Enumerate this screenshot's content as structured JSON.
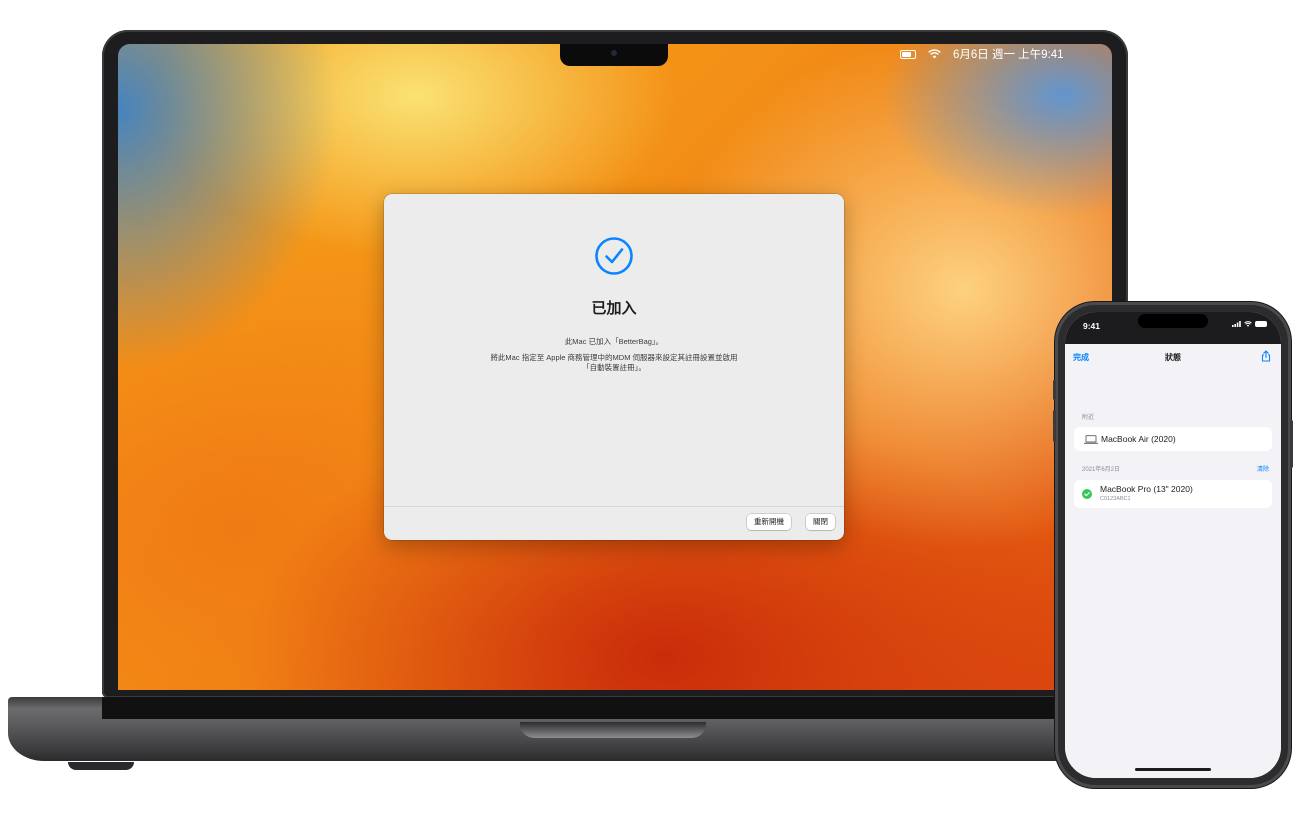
{
  "macbook": {
    "menubar": {
      "icons": [
        "battery-icon",
        "wifi-icon"
      ],
      "datetime": "6月6日 週一 上午9:41"
    },
    "dialog": {
      "icon": "checkmark-circle-icon",
      "title": "已加入",
      "message_line1": "此Mac 已加入「BetterBag」。",
      "message_line2": "將此Mac 指定至 Apple 商務管理中的MDM 伺服器來設定其註冊設置並啟用「自動裝置註冊」。",
      "buttons": {
        "restart": "重新開機",
        "close": "關閉"
      }
    },
    "colors": {
      "accent": "#0a84ff",
      "dialog_bg": "#ececec"
    }
  },
  "iphone": {
    "status_bar": {
      "time": "9:41",
      "icons": [
        "signal-icon",
        "wifi-icon",
        "battery-icon"
      ]
    },
    "nav": {
      "done": "完成",
      "title": "狀態",
      "share_icon": "share-icon"
    },
    "nearby": {
      "label": "附近",
      "device": "MacBook Air (2020)",
      "icon": "laptop-icon"
    },
    "history": {
      "label": "2021年6月2日",
      "clear": "清除",
      "device": "MacBook Pro (13\" 2020)",
      "serial": "C0123ABC1",
      "status_icon": "checkmark-circle-icon",
      "status_color": "#34c759"
    }
  }
}
